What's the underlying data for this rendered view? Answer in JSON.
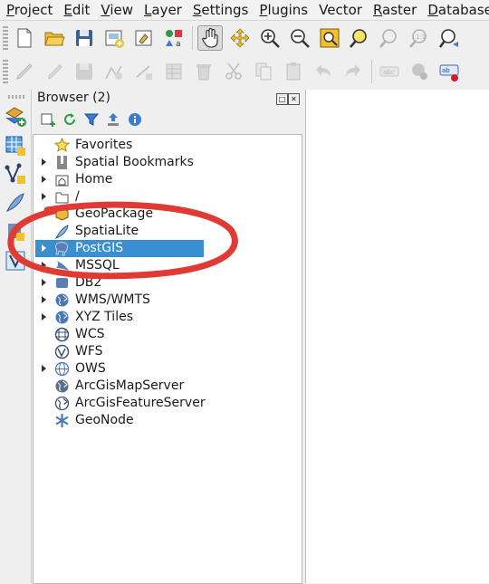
{
  "menubar": {
    "items": [
      {
        "first": "P",
        "rest": "roject"
      },
      {
        "first": "E",
        "rest": "dit"
      },
      {
        "first": "V",
        "rest": "iew"
      },
      {
        "first": "L",
        "rest": "ayer"
      },
      {
        "first": "S",
        "rest": "ettings"
      },
      {
        "first": "P",
        "rest": "lugins"
      },
      {
        "first": "",
        "rest": "Vector"
      },
      {
        "first": "R",
        "rest": "aster"
      },
      {
        "first": "D",
        "rest": "atabase"
      }
    ]
  },
  "toolbar_top": {
    "icons": [
      "new-project-icon",
      "open-project-icon",
      "save-project-icon",
      "new-print-layout-icon",
      "layout-manager-icon",
      "style-manager-icon",
      "pan-hand-icon",
      "pan-to-selection-icon",
      "zoom-in-icon",
      "zoom-out-icon",
      "zoom-full-icon",
      "zoom-to-selection-icon",
      "zoom-to-layer-icon",
      "zoom-native-icon",
      "zoom-last-icon"
    ]
  },
  "toolbar_edit": {
    "icons": [
      "toggle-editing-icon",
      "current-edits-icon",
      "save-edits-icon",
      "digitize-icon",
      "vertex-tool-icon",
      "modify-attributes-icon",
      "delete-selected-icon",
      "cut-features-icon",
      "copy-features-icon",
      "paste-features-icon",
      "undo-icon",
      "redo-icon",
      "label-abc-icon",
      "label-pin-icon",
      "label-toolbar-icon"
    ]
  },
  "left_toolbar": {
    "icons": [
      "add-vector-layer-icon",
      "add-raster-layer-icon",
      "add-delimited-text-icon",
      "add-spatialite-layer-icon",
      "add-postgis-layer-icon",
      "add-virtual-layer-icon"
    ]
  },
  "browser": {
    "title": "Browser (2)",
    "tools": [
      "add-layer-icon",
      "refresh-icon",
      "filter-icon",
      "collapse-all-icon",
      "info-icon"
    ],
    "items": [
      {
        "label": "Favorites",
        "icon": "star-icon",
        "arrow": false
      },
      {
        "label": "Spatial Bookmarks",
        "icon": "bookmark-icon",
        "arrow": true
      },
      {
        "label": "Home",
        "icon": "home-folder-icon",
        "arrow": true
      },
      {
        "label": "/",
        "icon": "folder-icon",
        "arrow": true
      },
      {
        "label": "GeoPackage",
        "icon": "geopackage-icon",
        "arrow": false
      },
      {
        "label": "SpatiaLite",
        "icon": "spatialite-feather-icon",
        "arrow": false
      },
      {
        "label": "PostGIS",
        "icon": "postgis-elephant-icon",
        "arrow": true,
        "selected": true
      },
      {
        "label": "MSSQL",
        "icon": "mssql-icon",
        "arrow": true
      },
      {
        "label": "DB2",
        "icon": "db2-icon",
        "arrow": true
      },
      {
        "label": "WMS/WMTS",
        "icon": "globe-icon",
        "arrow": true
      },
      {
        "label": "XYZ Tiles",
        "icon": "globe-icon",
        "arrow": true
      },
      {
        "label": "WCS",
        "icon": "wcs-globe-icon",
        "arrow": false
      },
      {
        "label": "WFS",
        "icon": "wfs-globe-icon",
        "arrow": false
      },
      {
        "label": "OWS",
        "icon": "ows-globe-icon",
        "arrow": true
      },
      {
        "label": "ArcGisMapServer",
        "icon": "arcgis-globe-icon",
        "arrow": false
      },
      {
        "label": "ArcGisFeatureServer",
        "icon": "arcgis-globe-icon",
        "arrow": false
      },
      {
        "label": "GeoNode",
        "icon": "geonode-icon",
        "arrow": false
      }
    ]
  },
  "colors": {
    "selection": "#3a8fd0",
    "annotation": "#e03a34"
  }
}
